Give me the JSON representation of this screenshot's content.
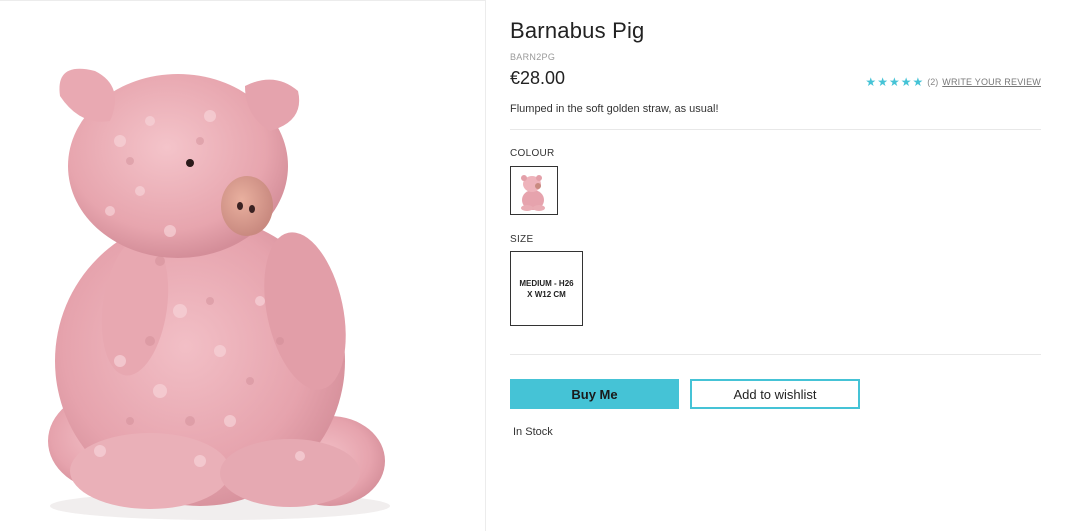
{
  "product": {
    "name": "Barnabus Pig",
    "sku": "BARN2PG",
    "price": "€28.00",
    "description": "Flumped in the soft golden straw, as usual!",
    "image_icon": "pig-plush-image"
  },
  "rating": {
    "stars_filled": 5,
    "stars_total": 5,
    "star_color": "#45c3d6",
    "count_text": "(2)",
    "write_review_label": "WRITE YOUR REVIEW"
  },
  "options": {
    "colour_label": "COLOUR",
    "size_label": "SIZE",
    "size_value": "MEDIUM - H26 X W12 CM"
  },
  "actions": {
    "buy_label": "Buy Me",
    "wishlist_label": "Add to wishlist",
    "accent_color": "#45c3d6"
  },
  "stock_status": "In Stock"
}
